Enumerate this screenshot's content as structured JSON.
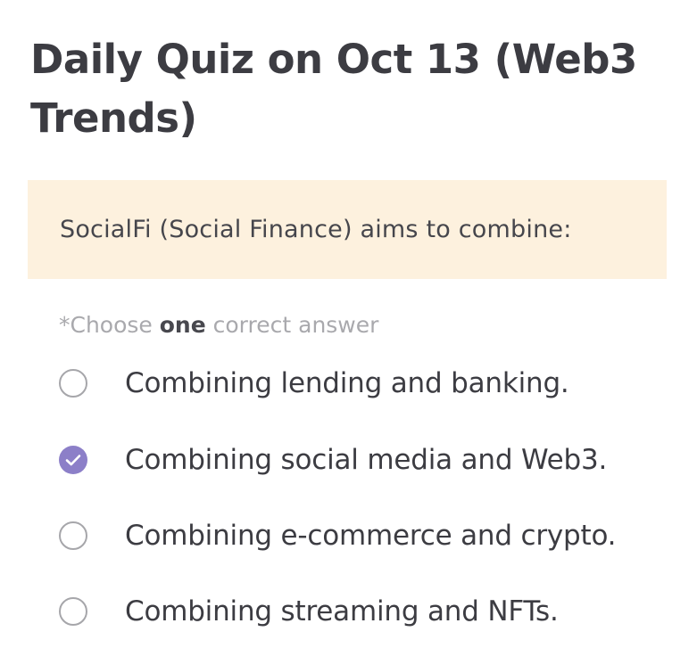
{
  "quiz": {
    "title": "Daily Quiz on Oct 13 (Web3 Trends)",
    "question": "SocialFi (Social Finance) aims to combine:",
    "instruction": {
      "prefix": "*Choose ",
      "emphasis": "one",
      "suffix": " correct answer"
    },
    "options": [
      {
        "label": "Combining lending and banking.",
        "selected": false
      },
      {
        "label": "Combining social media and Web3.",
        "selected": true
      },
      {
        "label": "Combining e-commerce and crypto.",
        "selected": false
      },
      {
        "label": "Combining streaming and NFTs.",
        "selected": false
      }
    ]
  },
  "colors": {
    "question_background": "#fdf1de",
    "selected_radio": "#8c7fc8",
    "unselected_radio_border": "#a6a6aa"
  }
}
